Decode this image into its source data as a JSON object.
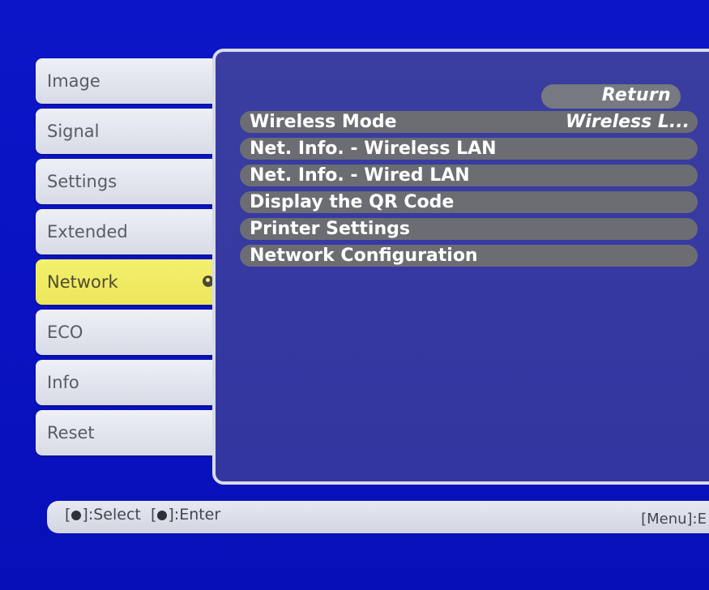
{
  "tabs": [
    {
      "label": "Image",
      "active": false
    },
    {
      "label": "Signal",
      "active": false
    },
    {
      "label": "Settings",
      "active": false
    },
    {
      "label": "Extended",
      "active": false
    },
    {
      "label": "Network",
      "active": true
    },
    {
      "label": "ECO",
      "active": false
    },
    {
      "label": "Info",
      "active": false
    },
    {
      "label": "Reset",
      "active": false
    }
  ],
  "panel": {
    "return_label": "Return",
    "items": [
      {
        "label": "Wireless Mode",
        "value": "Wireless L..."
      },
      {
        "label": "Net. Info. - Wireless LAN",
        "value": ""
      },
      {
        "label": "Net. Info. - Wired LAN",
        "value": ""
      },
      {
        "label": "Display the QR Code",
        "value": ""
      },
      {
        "label": "Printer Settings",
        "value": ""
      },
      {
        "label": "Network Configuration",
        "value": ""
      }
    ]
  },
  "help": {
    "select_prefix": "[",
    "select_suffix": "]:Select",
    "enter_prefix": "[",
    "enter_suffix": "]:Enter",
    "menu_text": "[Menu]:E"
  },
  "icons": {
    "select_icon": "updown-arrow-icon",
    "enter_icon": "enter-icon",
    "tab_enter_icon": "enter-icon"
  },
  "colors": {
    "background": "#0a12c2",
    "panel": "#3538a1",
    "active_tab": "#ece65a",
    "tab": "#e0e3ec",
    "item_pill": "#6b6d73"
  }
}
